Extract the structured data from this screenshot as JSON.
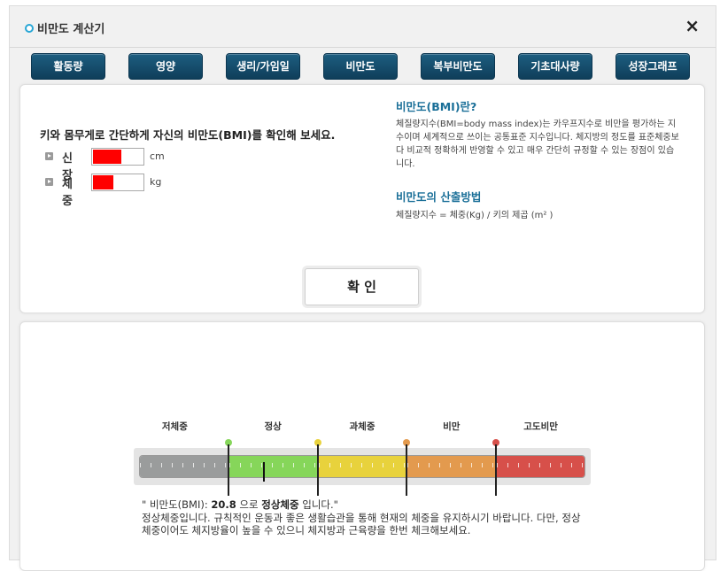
{
  "window": {
    "title": "비만도 계산기",
    "close_icon": "×"
  },
  "tabs": [
    "활동량",
    "영양",
    "생리/가임일",
    "비만도",
    "복부비만도",
    "기초대사량",
    "성장그래프"
  ],
  "form": {
    "prompt": "키와 몸무게로 간단하게 자신의 비만도(BMI)를 확인해 보세요.",
    "height_label": "신장",
    "height_unit": "cm",
    "weight_label": "체중",
    "weight_unit": "kg",
    "confirm_label": "확 인"
  },
  "info": {
    "section1_title": "비만도(BMI)란?",
    "section1_text": "체질량지수(BMI=body mass index)는 카우프지수로 비만을 평가하는 지수이며 세계적으로 쓰이는 공통표준 지수입니다. 체지방의 정도를 표준체중보다 비교적 정확하게 반영할 수 있고 매우 간단히 규정할 수 있는 장점이 있습니다.",
    "section2_title": "비만도의 산출방법",
    "section2_text": "체질량지수 = 체중(Kg) / 키의 제곱 (m² )"
  },
  "gauge": {
    "categories": [
      "저체중",
      "정상",
      "과체중",
      "비만",
      "고도비만"
    ],
    "category_colors": [
      "#9a9c9c",
      "#86d65a",
      "#e8d23c",
      "#e39a4e",
      "#d7504a"
    ],
    "dot_colors": [
      "#86d65a",
      "#e8d23c",
      "#e39a4e",
      "#d7504a"
    ],
    "marker_fraction_in_segment": 0.4
  },
  "result": {
    "prefix": "\" 비만도(BMI): ",
    "bmi_value": "20.8",
    "middle": " 으로 ",
    "status": "정상체중",
    "suffix": " 입니다.\"",
    "description": "정상체중입니다. 규칙적인 운동과 좋은 생활습관을 통해 현재의 체중을 유지하시기 바랍니다. 다만, 정상체중이어도 체지방율이 높을 수 있으니 체지방과 근육량을 한번 체크해보세요."
  }
}
